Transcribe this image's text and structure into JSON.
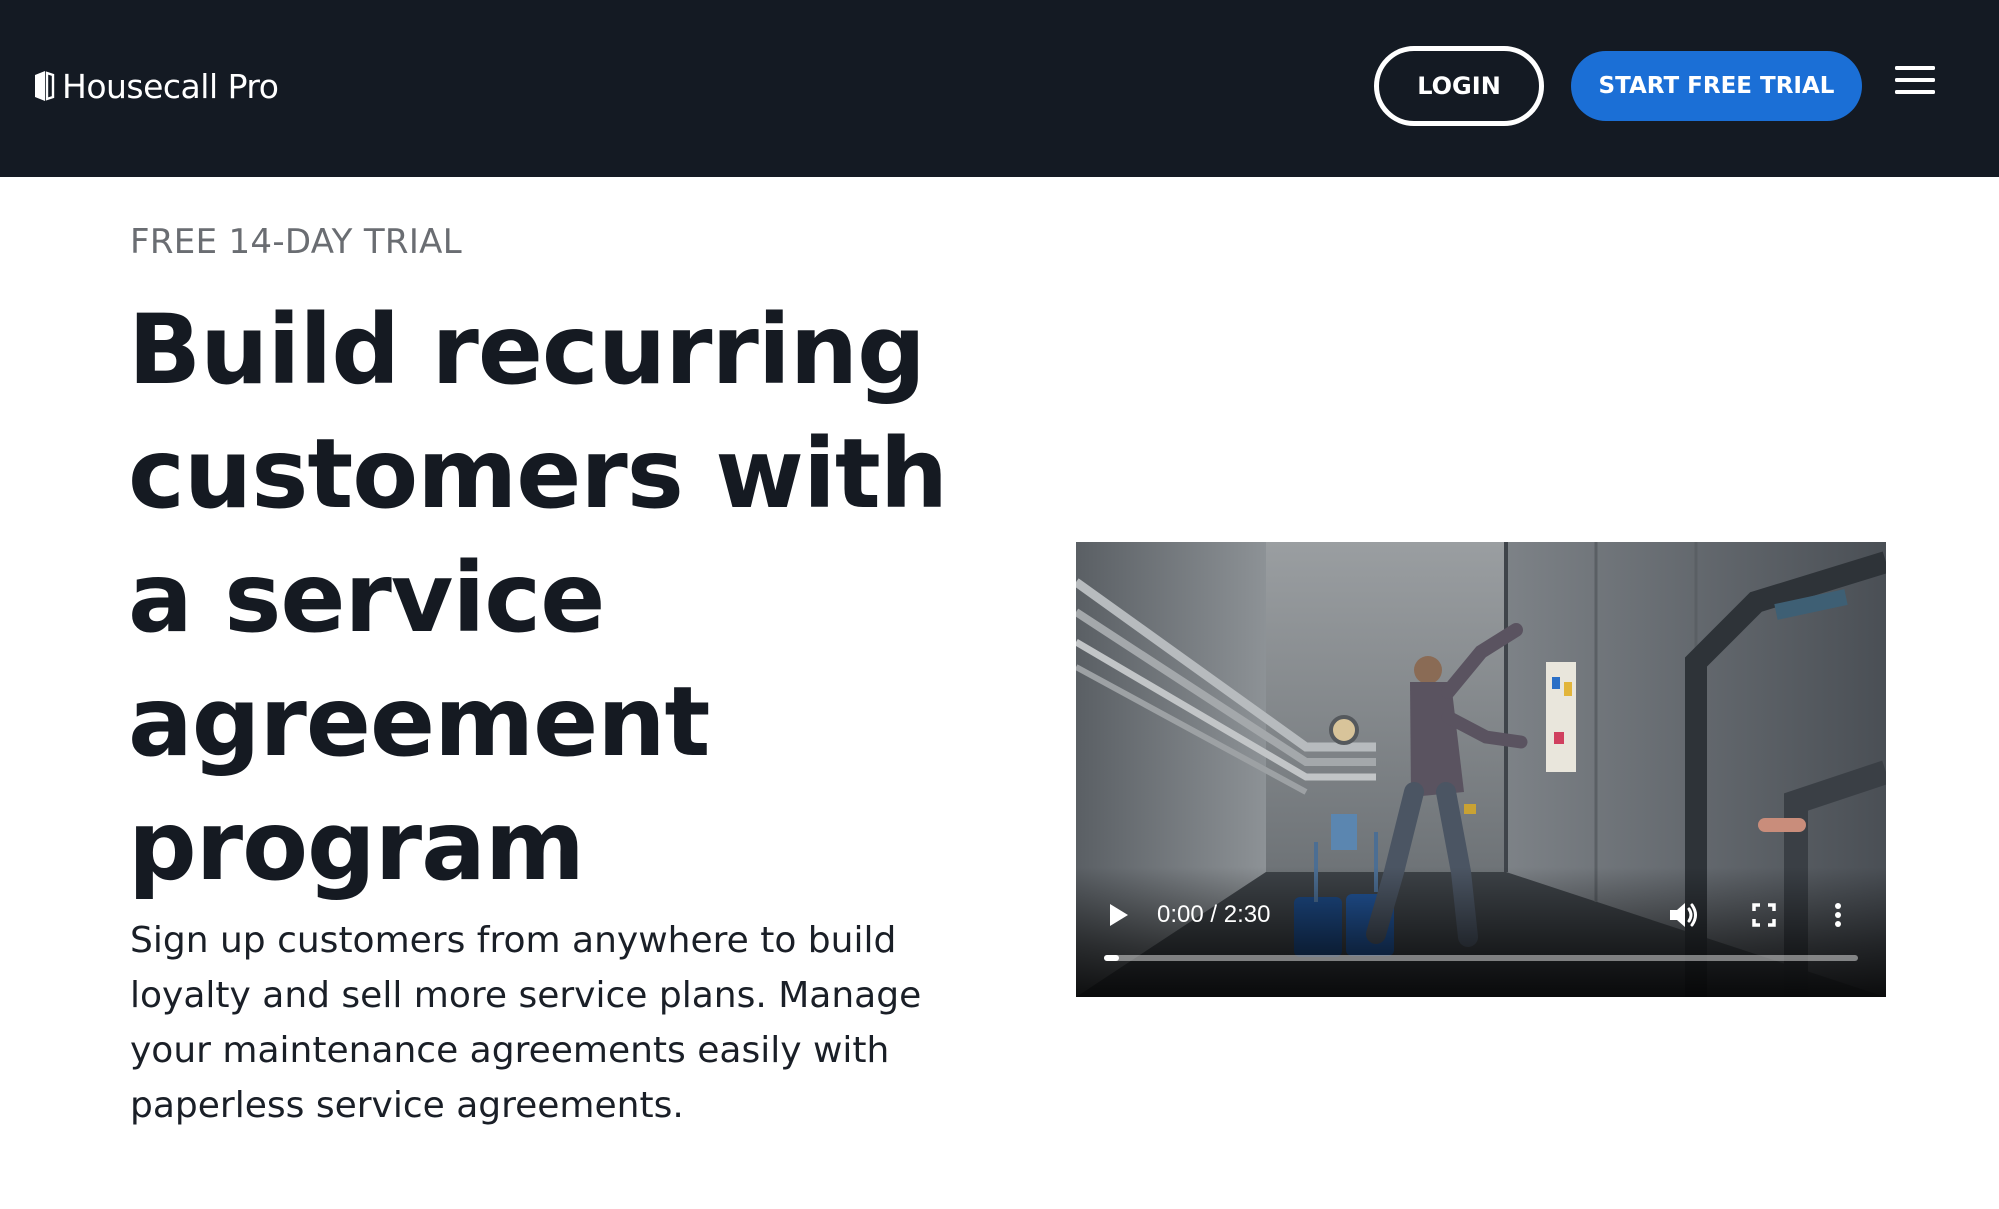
{
  "header": {
    "brand": "Housecall Pro",
    "login_label": "LOGIN",
    "trial_label": "START FREE TRIAL",
    "menu_icon": "hamburger-menu-icon",
    "background_color": "#141a23",
    "accent_color": "#1b6fd6"
  },
  "hero": {
    "eyebrow": "FREE 14-DAY TRIAL",
    "headline": "Build recurring customers with a service agreement program",
    "subcopy": "Sign up customers from anywhere to build loyalty and sell more service plans. Manage your maintenance agreements easily with paperless service agreements."
  },
  "video": {
    "time_readout": "0:00 / 2:30",
    "progress_fraction": 0.02,
    "icons": {
      "play": "play-icon",
      "volume": "volume-icon",
      "fullscreen": "fullscreen-icon",
      "more": "more-options-icon"
    }
  }
}
